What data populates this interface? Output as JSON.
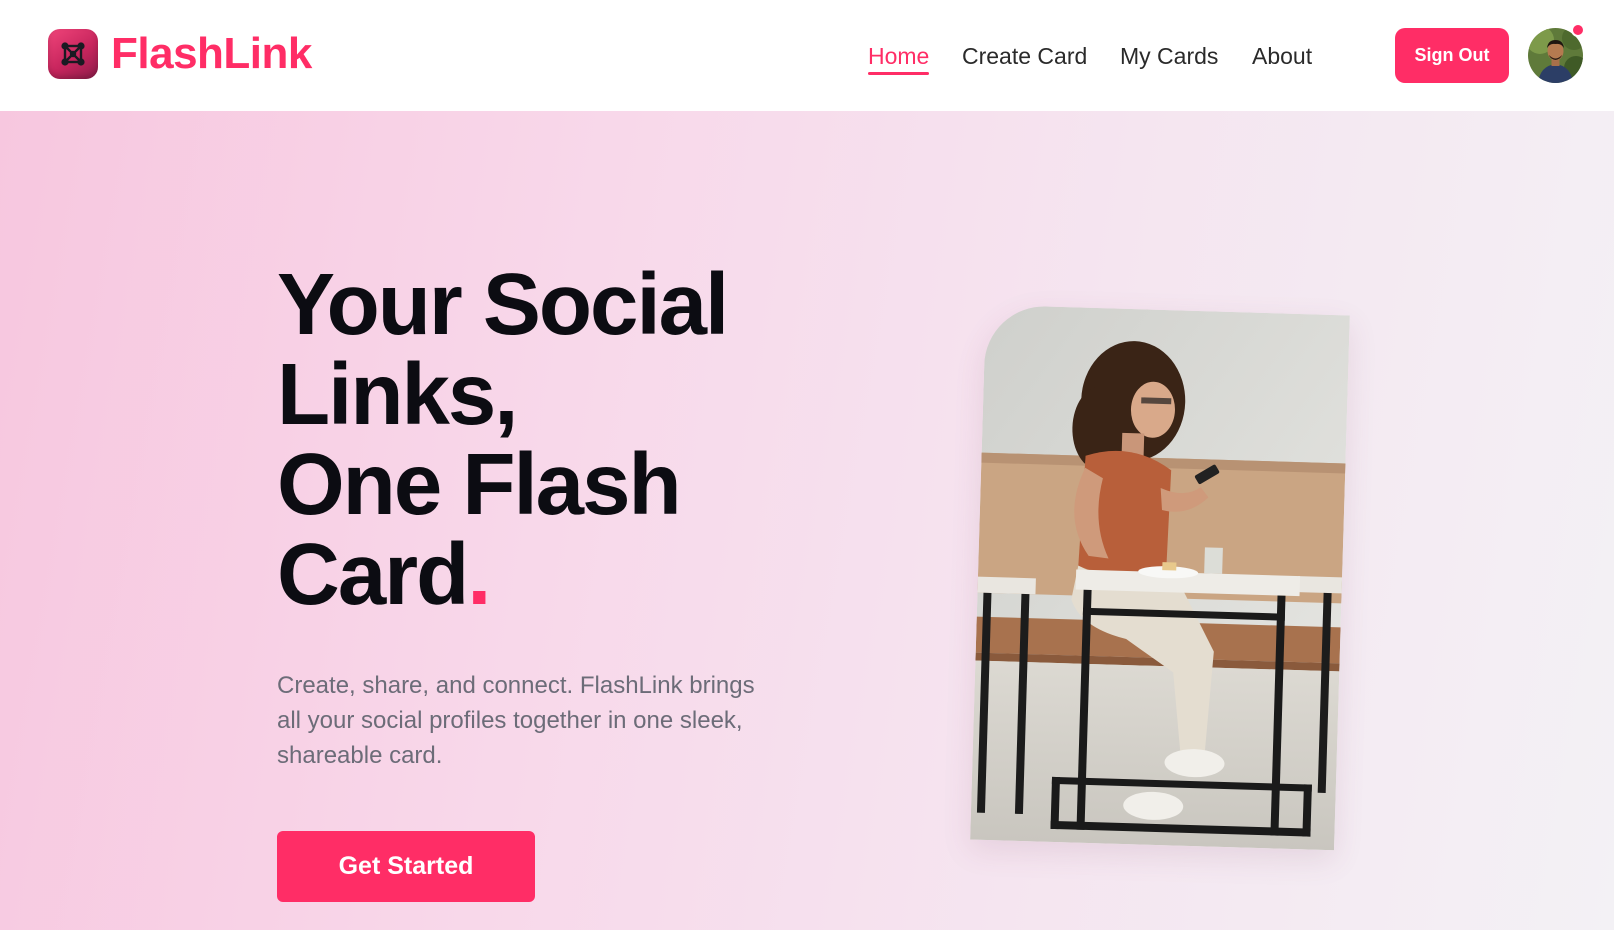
{
  "header": {
    "brand": "FlashLink",
    "nav": [
      {
        "label": "Home",
        "active": true
      },
      {
        "label": "Create Card",
        "active": false
      },
      {
        "label": "My Cards",
        "active": false
      },
      {
        "label": "About",
        "active": false
      }
    ],
    "signout_label": "Sign Out",
    "avatar_notification": true
  },
  "hero": {
    "title_lines": [
      "Your Social",
      "Links,",
      "One Flash",
      "Card"
    ],
    "title_accent": ".",
    "description": "Create, share, and connect. FlashLink brings all your social profiles together in one sleek, shareable card.",
    "cta_label": "Get Started"
  },
  "theme": {
    "accent": "#ff2d66",
    "text_dark": "#0c0c12",
    "text_muted": "#6c6c78"
  },
  "icons": {
    "logo": "network-nodes-icon",
    "notification": "notification-dot"
  }
}
